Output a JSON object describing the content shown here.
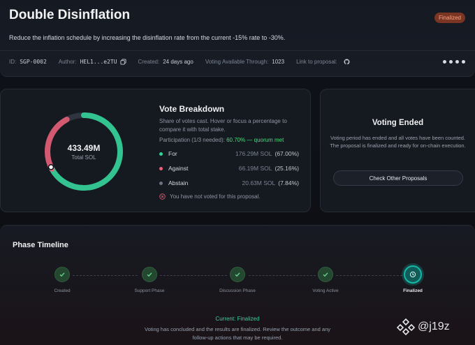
{
  "header": {
    "title": "Double Disinflation",
    "status": "Finalized",
    "description": "Reduce the inflation schedule by increasing the disinflation rate from the current -15% rate to -30%.",
    "meta": {
      "id_label": "ID:",
      "id_value": "SGP-0002",
      "author_label": "Author:",
      "author_value": "HEL1...e2TU",
      "created_label": "Created:",
      "created_value": "24 days ago",
      "voting_label": "Voting Available Through:",
      "voting_value": "1023",
      "link_label": "Link to proposal:"
    },
    "icons": {
      "copy": "copy-icon",
      "link": "github-icon",
      "more": "more-dots-icon"
    }
  },
  "vote_breakdown": {
    "title": "Vote Breakdown",
    "subtitle": "Share of votes cast. Hover or focus a percentage to compare it with total stake.",
    "participation_label": "Participation (1/3 needed):",
    "participation_value": "60.70% — quorum met",
    "total_value": "433.49M",
    "total_label": "Total SOL",
    "options": [
      {
        "name": "For",
        "amount": "176.29M SOL",
        "percent": "(67.00%)",
        "fraction": 0.67,
        "color": "#34d399"
      },
      {
        "name": "Against",
        "amount": "66.19M SOL",
        "percent": "(25.16%)",
        "fraction": 0.2516,
        "color": "#f0607a"
      },
      {
        "name": "Abstain",
        "amount": "20.63M SOL",
        "percent": "(7.84%)",
        "fraction": 0.0784,
        "color": "#4b5261"
      }
    ],
    "not_voted_note": "You have not voted for this proposal."
  },
  "voting_ended": {
    "title": "Voting Ended",
    "description": "Voting period has ended and all votes have been counted. The proposal is finalized and ready for on-chain execution.",
    "button_label": "Check Other Proposals"
  },
  "timeline": {
    "title": "Phase Timeline",
    "phases": [
      {
        "label": "Created",
        "state": "complete"
      },
      {
        "label": "Support Phase",
        "state": "complete"
      },
      {
        "label": "Discussion Phase",
        "state": "complete"
      },
      {
        "label": "Voting Active",
        "state": "complete"
      },
      {
        "label": "Finalized",
        "state": "current"
      }
    ],
    "current_label": "Current: Finalized",
    "current_description": "Voting has concluded and the results are finalized. Review the outcome and any follow-up actions that may be required."
  },
  "watermark": {
    "text": "@j19z"
  }
}
